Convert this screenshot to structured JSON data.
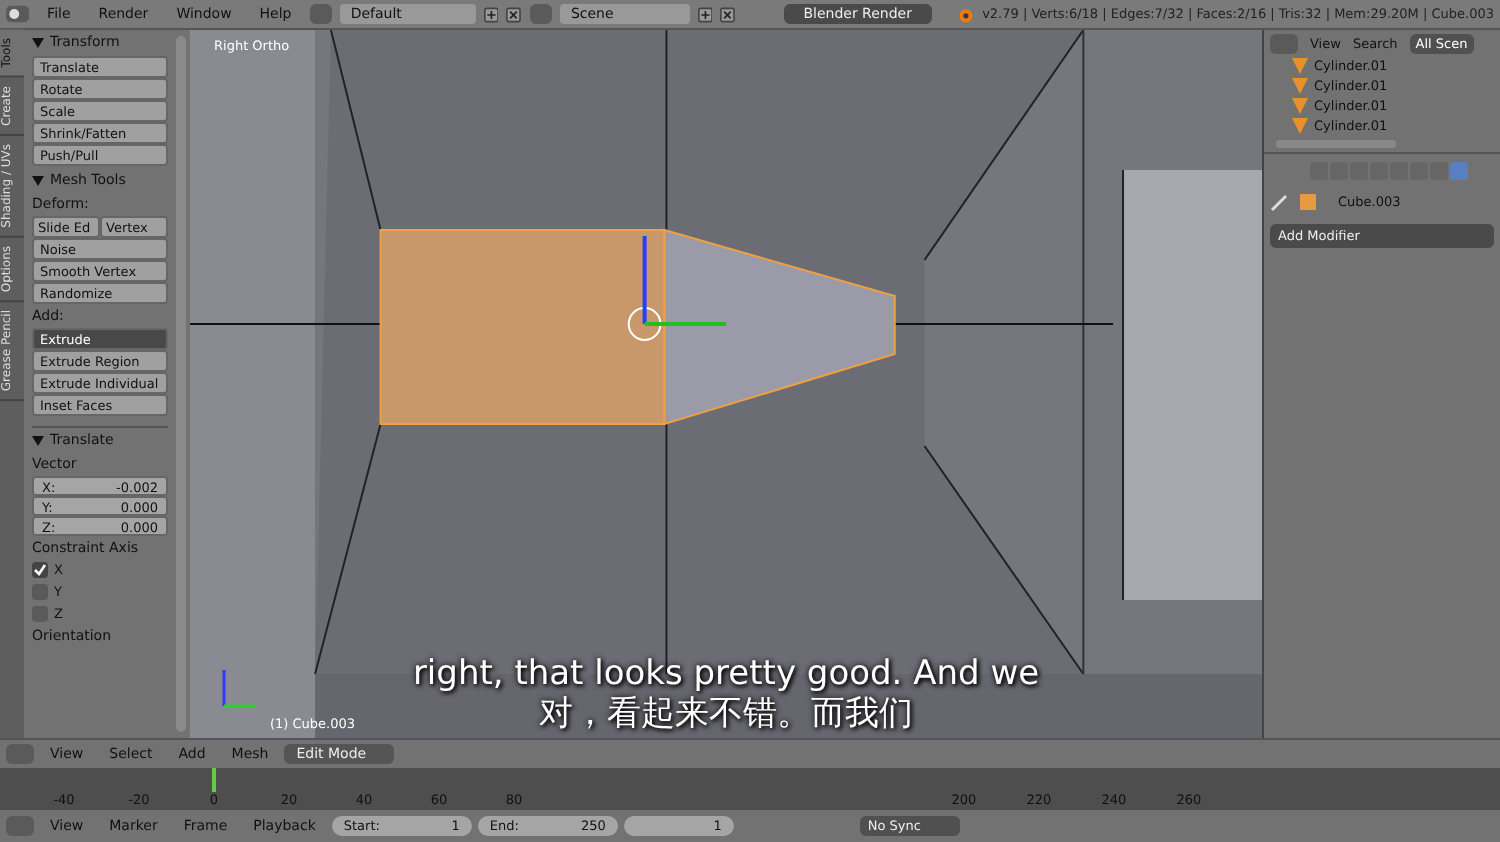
{
  "top_bar": {
    "menu": [
      "File",
      "Render",
      "Window",
      "Help"
    ],
    "layout": "Default",
    "scene": "Scene",
    "engine": "Blender Render",
    "stats": "v2.79 | Verts:6/18 | Edges:7/32 | Faces:2/16 | Tris:32 | Mem:29.20M | Cube.003"
  },
  "tool_tabs": [
    {
      "label": "Tools",
      "selected": true
    },
    {
      "label": "Create",
      "selected": false
    },
    {
      "label": "Shading / UVs",
      "selected": false
    },
    {
      "label": "Options",
      "selected": false
    },
    {
      "label": "Grease Pencil",
      "selected": false
    }
  ],
  "transform": {
    "title": "Transform",
    "buttons": [
      "Translate",
      "Rotate",
      "Scale",
      "Shrink/Fatten",
      "Push/Pull"
    ]
  },
  "mesh_tools": {
    "title": "Mesh Tools",
    "deform_label": "Deform:",
    "deform_pair": [
      "Slide Ed",
      "Vertex"
    ],
    "deform_buttons": [
      "Noise",
      "Smooth Vertex",
      "Randomize"
    ],
    "add_label": "Add:",
    "extrude": "Extrude",
    "add_buttons": [
      "Extrude Region",
      "Extrude Individual",
      "Inset Faces"
    ]
  },
  "operator": {
    "title": "Translate",
    "vector_label": "Vector",
    "fields": [
      {
        "axis": "X:",
        "value": "-0.002"
      },
      {
        "axis": "Y:",
        "value": "0.000"
      },
      {
        "axis": "Z:",
        "value": "0.000"
      }
    ],
    "constraint_label": "Constraint Axis",
    "constraints": [
      {
        "label": "X",
        "checked": true
      },
      {
        "label": "Y",
        "checked": false
      },
      {
        "label": "Z",
        "checked": false
      }
    ],
    "orientation_label": "Orientation"
  },
  "viewport": {
    "view_label": "Right Ortho",
    "object_label": "(1) Cube.003",
    "subtitles": [
      "right, that looks pretty good. And we",
      "对，看起来不错。而我们"
    ]
  },
  "outliner": {
    "view": "View",
    "search": "Search",
    "scope": "All Scen",
    "items": [
      "Cylinder.01",
      "Cylinder.01",
      "Cylinder.01",
      "Cylinder.01"
    ]
  },
  "properties": {
    "object": "Cube.003",
    "add_modifier": "Add Modifier"
  },
  "view3d_header": {
    "menu": [
      "View",
      "Select",
      "Add",
      "Mesh"
    ],
    "mode": "Edit Mode"
  },
  "timeline": {
    "ticks": [
      "-40",
      "-20",
      "0",
      "20",
      "40",
      "60",
      "80",
      "200",
      "220",
      "240",
      "260"
    ]
  },
  "footer": {
    "menu": [
      "View",
      "Marker",
      "Frame",
      "Playback"
    ],
    "start_label": "Start:",
    "start": "1",
    "end_label": "End:",
    "end": "250",
    "current": "1",
    "sync": "No Sync"
  }
}
